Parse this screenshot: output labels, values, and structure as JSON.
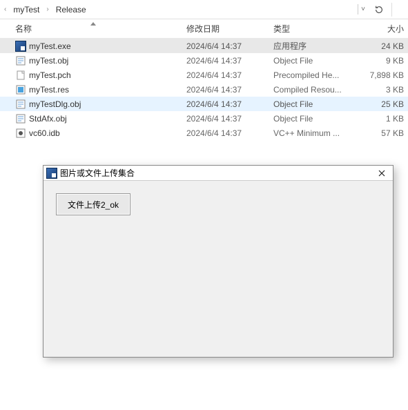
{
  "breadcrumb": {
    "items": [
      "myTest",
      "Release"
    ]
  },
  "columns": {
    "name": "名称",
    "date": "修改日期",
    "type": "类型",
    "size": "大小"
  },
  "files": [
    {
      "name": "myTest.exe",
      "date": "2024/6/4 14:37",
      "type": "应用程序",
      "size": "24 KB",
      "icon": "app",
      "state": "selected"
    },
    {
      "name": "myTest.obj",
      "date": "2024/6/4 14:37",
      "type": "Object File",
      "size": "9 KB",
      "icon": "obj",
      "state": ""
    },
    {
      "name": "myTest.pch",
      "date": "2024/6/4 14:37",
      "type": "Precompiled He...",
      "size": "7,898 KB",
      "icon": "blank",
      "state": ""
    },
    {
      "name": "myTest.res",
      "date": "2024/6/4 14:37",
      "type": "Compiled Resou...",
      "size": "3 KB",
      "icon": "res",
      "state": ""
    },
    {
      "name": "myTestDlg.obj",
      "date": "2024/6/4 14:37",
      "type": "Object File",
      "size": "25 KB",
      "icon": "obj",
      "state": "hover"
    },
    {
      "name": "StdAfx.obj",
      "date": "2024/6/4 14:37",
      "type": "Object File",
      "size": "1 KB",
      "icon": "obj",
      "state": ""
    },
    {
      "name": "vc60.idb",
      "date": "2024/6/4 14:37",
      "type": "VC++ Minimum ...",
      "size": "57 KB",
      "icon": "idb",
      "state": ""
    }
  ],
  "dialog": {
    "title": "图片或文件上传集合",
    "button_label": "文件上传2_ok"
  }
}
